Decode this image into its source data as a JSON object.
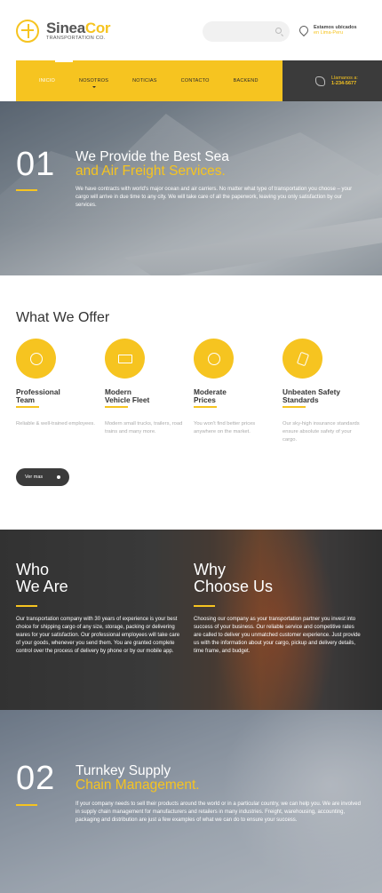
{
  "header": {
    "brand_part1": "Sinea",
    "brand_part2": "Cor",
    "brand_sub": "TRANSPORTATION CO.",
    "location_title": "Estamos ubicados",
    "location_value": "en Lima-Peru",
    "call_title": "Llamanos a:",
    "call_number": "1-234-5677"
  },
  "nav": {
    "items": [
      "INICIO",
      "NOSOTROS",
      "NOTICIAS",
      "CONTACTO",
      "BACKEND"
    ],
    "active": "INICIO"
  },
  "hero1": {
    "number": "01",
    "title_white": "We Provide the Best Sea",
    "title_yellow": "and Air Freight Services.",
    "text": "We have contracts with world's major ocean and air carriers. No matter what type of transportation you choose – your cargo will arrive in due time to any city. We will take care of all the paperwork, leaving you only satisfaction by our services."
  },
  "offer": {
    "title": "What We Offer",
    "features": [
      {
        "title_line1": "Professional",
        "title_line2": "Team",
        "desc": "Reliable & well-trained employees.",
        "icon": "support-icon"
      },
      {
        "title_line1": "Modern",
        "title_line2": "Vehicle Fleet",
        "desc": "Modern small trucks, trailers, road trains and many more.",
        "icon": "truck-icon"
      },
      {
        "title_line1": "Moderate",
        "title_line2": "Prices",
        "desc": "You won't find better prices anywhere on the market.",
        "icon": "coins-icon"
      },
      {
        "title_line1": "Unbeaten Safety",
        "title_line2": "Standards",
        "desc": "Our sky-high insurance standards ensure absolute safety of your cargo.",
        "icon": "tag-icon"
      }
    ],
    "more_label": "Ver mas"
  },
  "who": {
    "head_line1": "Who",
    "head_line2": "We Are",
    "text": "Our transportation company with 30 years of experience is your best choice for shipping cargo of any size, storage, packing or delivering wares for your satisfaction. Our professional employees will take care of your goods, whenever you send them. You are granted complete control over the process of delivery by phone or by our mobile app."
  },
  "why": {
    "head_line1": "Why",
    "head_line2": "Choose Us",
    "text": "Choosing our company as your transportation partner you invest into success of your business. Our reliable service and competitive rates are called to deliver you unmatched customer experience. Just provide us with the information about your cargo, pickup and delivery details, time frame, and budget."
  },
  "hero2": {
    "number": "02",
    "title_white": "Turnkey Supply",
    "title_yellow": "Chain Management.",
    "text": "If your company needs to sell their products around the world or in a particular country, we can help you. We are involved in supply chain management for manufacturers and retailers in many industries. Freight, warehousing, accounting, packaging and distribution are just a few examples of what we can do to ensure your success."
  },
  "colors": {
    "accent": "#f6c420",
    "dark": "#3b3b3b"
  }
}
